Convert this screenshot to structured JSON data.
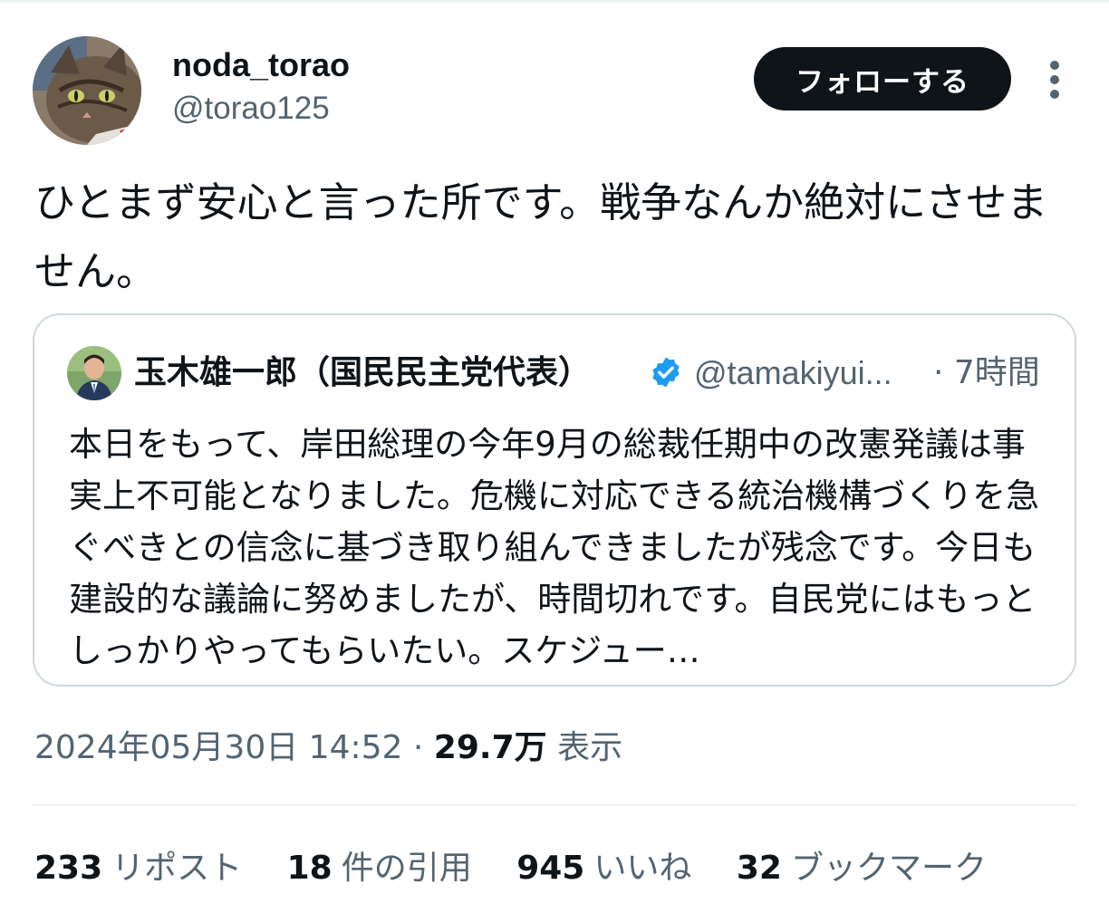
{
  "author": {
    "display_name": "noda_torao",
    "handle": "@torao125"
  },
  "follow_button_label": "フォローする",
  "tweet_text": "ひとまず安心と言った所です。戦争なんか絶対にさせません。",
  "quoted": {
    "display_name": "玉木雄一郎（国民民主党代表）",
    "handle": "@tamakiyui...",
    "time": "· 7時間",
    "text": "本日をもって、岸田総理の今年9月の総裁任期中の改憲発議は事実上不可能となりました。危機に対応できる統治機構づくりを急ぐべきとの信念に基づき取り組んできましたが残念です。今日も建設的な議論に努めましたが、時間切れです。自民党にはもっとしっかりやってもらいたい。スケジュー…",
    "verified_color": "#1d9bf0"
  },
  "meta": {
    "timestamp": "2024年05月30日 14:52",
    "separator": "·",
    "views_count": "29.7万",
    "views_label": "表示"
  },
  "stats": {
    "reposts_count": "233",
    "reposts_label": "リポスト",
    "quotes_count": "18",
    "quotes_label": "件の引用",
    "likes_count": "945",
    "likes_label": "いいね",
    "bookmarks_count": "32",
    "bookmarks_label": "ブックマーク"
  },
  "icons": {
    "more": "more-vertical-icon",
    "verified": "verified-badge-icon"
  },
  "colors": {
    "text_primary": "#0f1419",
    "text_secondary": "#536471",
    "border": "#cfd9de",
    "follow_bg": "#0f1419"
  }
}
